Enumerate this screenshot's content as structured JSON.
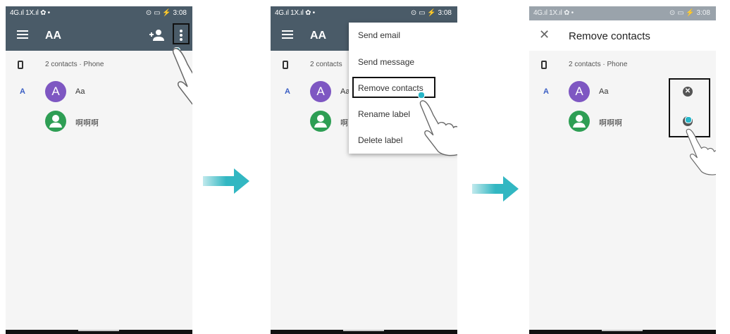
{
  "status": {
    "left": "4G.ıl 1X.ıl ✿ •",
    "right": "⊙ ▭ ⚡ 3:08"
  },
  "step1": {
    "label_title": "AA",
    "account": "2 contacts · Phone",
    "section_letter": "A",
    "contacts": [
      {
        "initial": "A",
        "name": "Aa"
      },
      {
        "initial": "",
        "name": "啊啊啊"
      }
    ]
  },
  "step2": {
    "label_title": "AA",
    "account": "2 contacts",
    "section_letter": "A",
    "contacts": [
      {
        "initial": "A",
        "name": "Aa"
      },
      {
        "initial": "",
        "name": "啊"
      }
    ],
    "menu": [
      "Send email",
      "Send message",
      "Remove contacts",
      "Rename label",
      "Delete label"
    ]
  },
  "step3": {
    "title": "Remove contacts",
    "account": "2 contacts · Phone",
    "section_letter": "A",
    "contacts": [
      {
        "initial": "A",
        "name": "Aa"
      },
      {
        "initial": "",
        "name": "啊啊啊"
      }
    ]
  },
  "colors": {
    "appbar": "#4a5b68",
    "accent": "#27b6c8",
    "arrow": "#32b7c2",
    "avatar_a": "#7e57c2",
    "avatar_b": "#2e9e54"
  },
  "icons": [
    "menu-icon",
    "add-person-icon",
    "more-vert-icon",
    "phone-icon",
    "person-icon",
    "close-icon",
    "remove-circle-icon",
    "pointing-hand-icon",
    "arrow-right-icon"
  ]
}
